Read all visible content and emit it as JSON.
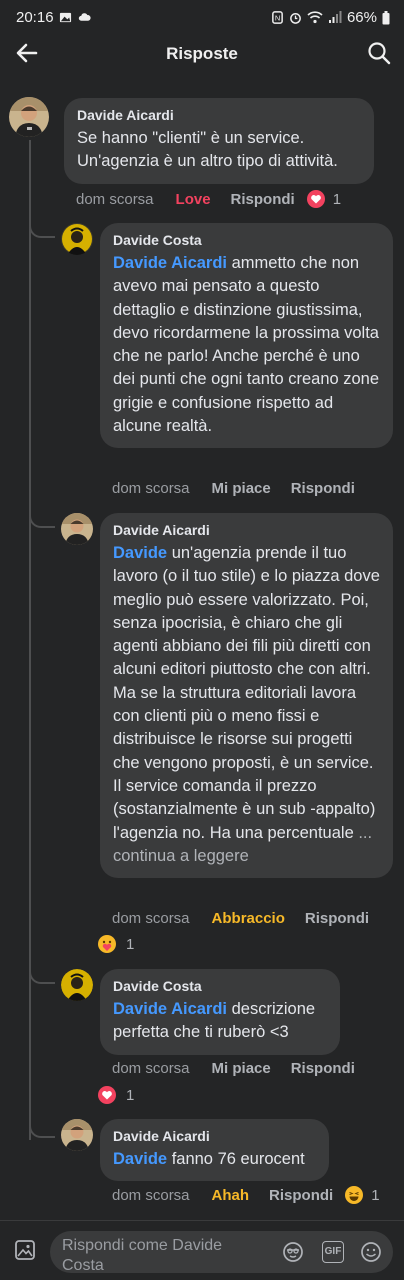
{
  "status_bar": {
    "time": "20:16",
    "battery": "66%"
  },
  "header": {
    "title": "Risposte"
  },
  "comments": [
    {
      "author": "Davide Aicardi",
      "mention": "",
      "text": "Se hanno \"clienti\" è un service. Un'agenzia è un altro tipo di attività.",
      "more": "",
      "time": "dom scorsa",
      "reaction_label": "Love",
      "reply_label": "Rispondi",
      "reaction_emoji": "heart",
      "reaction_count": "1"
    },
    {
      "author": "Davide Costa",
      "mention": "Davide Aicardi",
      "text": " ammetto che non avevo mai pensato a questo dettaglio e distinzione giustissima, devo ricordarmene la prossima volta che ne parlo! Anche perché è uno dei punti che ogni tanto creano zone grigie e confusione rispetto ad alcune realtà.",
      "more": "",
      "time": "dom scorsa",
      "reaction_label": "Mi piace",
      "reply_label": "Rispondi"
    },
    {
      "author": "Davide Aicardi",
      "mention": "Davide",
      "text": " un'agenzia prende il tuo lavoro (o il tuo stile) e lo piazza dove meglio può essere valorizzato. Poi, senza ipocrisia, è chiaro che gli agenti abbiano dei fili più diretti con alcuni editori piuttosto che con altri. Ma se la struttura editoriali lavora con clienti più o meno fissi e distribuisce le risorse sui progetti che vengono proposti, è un service. Il service comanda il prezzo (sostanzialmente è un sub -appalto) l'agenzia no. Ha una percentuale ",
      "more": "... continua a leggere",
      "time": "dom scorsa",
      "reaction_label": "Abbraccio",
      "reply_label": "Rispondi",
      "reaction_emoji": "care",
      "reaction_count": "1"
    },
    {
      "author": "Davide Costa",
      "mention": "Davide Aicardi",
      "text": " descrizione perfetta che ti ruberò <3",
      "more": "",
      "time": "dom scorsa",
      "reaction_label": "Mi piace",
      "reply_label": "Rispondi",
      "reaction_emoji": "heart",
      "reaction_count": "1"
    },
    {
      "author": "Davide Aicardi",
      "mention": "Davide",
      "text": " fanno 76 eurocent",
      "more": "",
      "time": "dom scorsa",
      "reaction_label": "Ahah",
      "reply_label": "Rispondi",
      "reaction_emoji": "haha",
      "reaction_count": "1"
    }
  ],
  "composer": {
    "placeholder": "Rispondi come Davide Costa",
    "gif_label": "GIF"
  },
  "colors": {
    "background": "#242526",
    "bubble": "#3a3b3c",
    "mention": "#4599ff",
    "love": "#f3425f",
    "yellow_reaction": "#f7b928"
  }
}
